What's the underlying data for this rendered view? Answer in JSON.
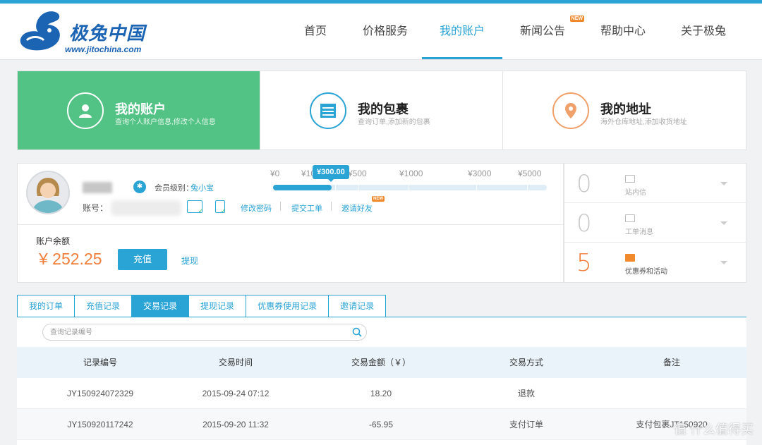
{
  "brand": {
    "name": "极兔中国",
    "url": "www.jitochina.com",
    "color": "#1b63b3"
  },
  "nav": {
    "items": [
      {
        "label": "首页",
        "active": false
      },
      {
        "label": "价格服务",
        "active": false
      },
      {
        "label": "我的账户",
        "active": true
      },
      {
        "label": "新闻公告",
        "active": false,
        "badge": "NEW"
      },
      {
        "label": "帮助中心",
        "active": false
      },
      {
        "label": "关于极兔",
        "active": false
      }
    ]
  },
  "panels": [
    {
      "title": "我的账户",
      "subtitle": "查询个人账户信息,修改个人信息",
      "icon": "user-icon",
      "active": true
    },
    {
      "title": "我的包裹",
      "subtitle": "查询订单,添加新的包裹",
      "icon": "package-icon",
      "active": false
    },
    {
      "title": "我的地址",
      "subtitle": "海外仓库地址,添加收货地址",
      "icon": "location-pin-icon",
      "active": false
    }
  ],
  "account": {
    "level_label": "会员级别：",
    "level_value": "兔小宝",
    "account_label": "账号：",
    "links": {
      "change_password": "修改密码",
      "submit_ticket": "提交工单",
      "invite_friends": "邀请好友",
      "invite_badge": "NEW"
    },
    "progress": {
      "ticks": [
        "¥0",
        "¥100",
        "¥500",
        "¥1000",
        "¥3000",
        "¥5000"
      ],
      "current": "¥300.00",
      "fraction": 0.215
    },
    "balance_label": "账户余额",
    "balance_value": "¥ 252.25",
    "charge_button": "充值",
    "withdraw_link": "提现"
  },
  "stats": [
    {
      "count": "0",
      "label": "站内信",
      "icon": "mail-icon"
    },
    {
      "count": "0",
      "label": "工单消息",
      "icon": "ticket-icon"
    },
    {
      "count": "5",
      "label": "优惠券和活动",
      "icon": "coupon-icon"
    }
  ],
  "tabs": [
    {
      "label": "我的订单",
      "active": false
    },
    {
      "label": "充值记录",
      "active": false
    },
    {
      "label": "交易记录",
      "active": true
    },
    {
      "label": "提现记录",
      "active": false
    },
    {
      "label": "优惠券使用记录",
      "active": false
    },
    {
      "label": "邀请记录",
      "active": false
    }
  ],
  "search": {
    "placeholder": "查询记录编号"
  },
  "table": {
    "columns": [
      "记录编号",
      "交易时间",
      "交易金额（￥）",
      "交易方式",
      "备注"
    ],
    "rows": [
      [
        "JY150924072329",
        "2015-09-24 07:12",
        "18.20",
        "退款",
        ""
      ],
      [
        "JY150920117242",
        "2015-09-20 11:32",
        "-65.95",
        "支付订单",
        "支付包裹JT150920"
      ]
    ]
  },
  "watermark": "值 什么值得买",
  "colors": {
    "accent": "#2aa3d5",
    "green": "#52c285",
    "orange": "#f07f3c"
  }
}
